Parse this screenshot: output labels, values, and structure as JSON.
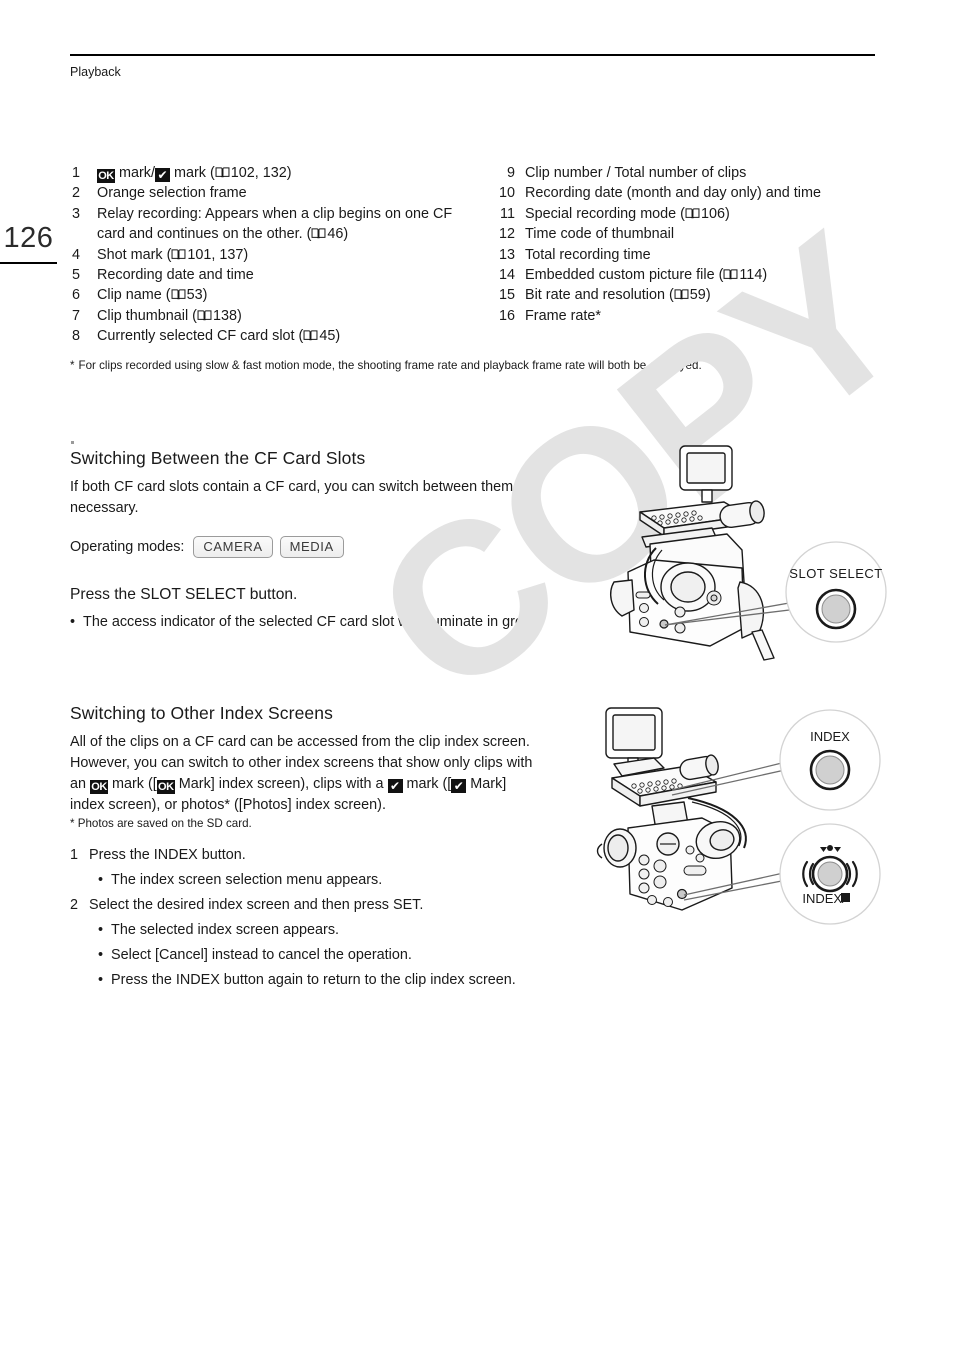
{
  "header": {
    "section_title": "Playback",
    "page_number": "126"
  },
  "legend": {
    "left_items": [
      {
        "num": "1",
        "text_before": "",
        "glyphs": [
          "ok-mark",
          "check-mark"
        ],
        "text": " mark/",
        "text2": " mark (",
        "ref": "102, 132",
        "text3": ")"
      },
      {
        "num": "2",
        "text": "Orange selection frame"
      },
      {
        "num": "3",
        "text": "Relay recording: Appears when a clip begins on one CF card and continues on the other. (",
        "ref": "46",
        "text3": ")"
      },
      {
        "num": "4",
        "text": "Shot mark (",
        "ref": "101, 137",
        "text3": ")"
      },
      {
        "num": "5",
        "text": "Recording date and time"
      },
      {
        "num": "6",
        "text": "Clip name (",
        "ref": "53",
        "text3": ")"
      },
      {
        "num": "7",
        "text": "Clip thumbnail (",
        "ref": "138",
        "text3": ")"
      },
      {
        "num": "8",
        "text": "Currently selected CF card slot (",
        "ref": "45",
        "text3": ")"
      }
    ],
    "right_items": [
      {
        "num": "9",
        "text": "Clip number / Total number of clips"
      },
      {
        "num": "10",
        "text": "Recording date (month and day only) and time"
      },
      {
        "num": "11",
        "text": "Special recording mode (",
        "ref": "106",
        "text3": ")"
      },
      {
        "num": "12",
        "text": "Time code of thumbnail"
      },
      {
        "num": "13",
        "text": "Total recording time"
      },
      {
        "num": "14",
        "text": "Embedded custom picture file (",
        "ref": "114",
        "text3": ")"
      },
      {
        "num": "15",
        "text": "Bit rate and resolution (",
        "ref": "59",
        "text3": ")"
      },
      {
        "num": "16",
        "text": "Frame rate*"
      }
    ],
    "footnote_marker": "*",
    "footnote": "For clips recorded using slow & fast motion mode, the shooting frame rate and playback frame rate will both be displayed."
  },
  "section_slots": {
    "heading": "Switching Between the CF Card Slots",
    "intro": "If both CF card slots contain a CF card, you can switch between them as necessary.",
    "operating_modes_label": "Operating modes:",
    "operating_modes": [
      "CAMERA",
      "MEDIA"
    ],
    "step_heading": "Press the SLOT SELECT button.",
    "bullet": "The access indicator of the selected CF card slot will illuminate in green."
  },
  "section_index": {
    "heading": "Switching to Other Index Screens",
    "para_line1": "All of the clips on a CF card can be accessed from the clip index screen.",
    "para_line2": "However, you can switch to other index screens that show only clips with",
    "para_line3_a": "an ",
    "para_line3_b": " mark ([",
    "para_line3_c": " Mark] index screen), clips with a ",
    "para_line3_d": " mark ([",
    "para_line3_e": " Mark]",
    "para_line4": "index screen), or photos* ([Photos] index screen).",
    "footnote_marker": "*",
    "footnote": "Photos are saved on the SD card.",
    "steps": [
      {
        "num": "1",
        "text": "Press the INDEX button."
      },
      {
        "num": "2",
        "text": "Select the desired index screen and then press SET."
      }
    ],
    "bullets": [
      "The index screen selection menu appears.",
      "The selected index screen appears.",
      "Select [Cancel] instead to cancel the operation.",
      "Press the INDEX button again to return to the clip index screen."
    ]
  },
  "illustrations": {
    "slot_select_callout": "SLOT SELECT",
    "index_callout_top": "INDEX",
    "index_callout_bottom": "INDEX/"
  },
  "glyphs": {
    "ok_mark": "OK",
    "check_mark": "✔",
    "bullet": "•"
  },
  "watermark": {
    "text": "COPY"
  },
  "colors": {
    "text": "#1a1a1a",
    "rule": "#000000",
    "watermark": "#e3e3e3",
    "badge_border": "#9b9b9b",
    "mark_bg": "#111111"
  }
}
